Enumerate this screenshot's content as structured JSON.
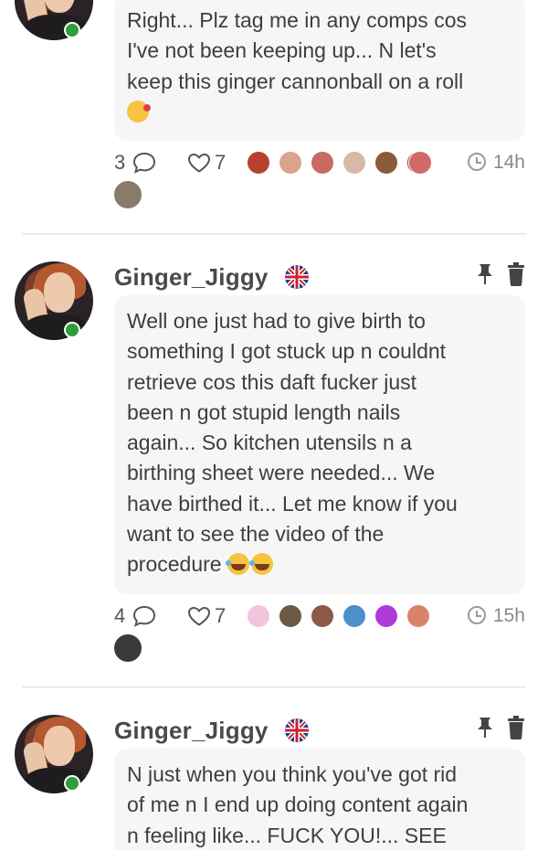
{
  "posts": [
    {
      "body_lines": [
        "Right... Plz tag me in any comps cos",
        "I've not been keeping up... N let's",
        "keep this ginger cannonball on a roll"
      ],
      "emoji": "kiss-emoji",
      "comments": "3",
      "likes": "7",
      "time": "14h",
      "liker_colors": [
        "#b8402f",
        "#d9a48a",
        "#c96a62",
        "#d8b9a6",
        "#8a5a3a",
        "#7a4c35",
        "#d06a6a"
      ],
      "extra_liker_color": "#8a7a6a"
    },
    {
      "username": "Ginger_Jiggy",
      "body_lines": [
        "Well one just had to give birth to",
        "something I got stuck up n couldnt",
        "retrieve cos this daft fucker just",
        "been n got stupid length nails",
        "again... So kitchen utensils n a",
        "birthing sheet were needed... We",
        "have birthed it... Let me know if you",
        "want to see the video of the",
        "procedure"
      ],
      "emoji": "laughing-tears-emoji",
      "comments": "4",
      "likes": "7",
      "time": "15h",
      "liker_colors": [
        "#f2c4de",
        "#6d5a44",
        "#8a5a46",
        "#4d8fc8",
        "#b03ad8",
        "#d9846a"
      ],
      "extra_liker_color": "#3a3a3a"
    },
    {
      "username": "Ginger_Jiggy",
      "body_lines": [
        "N just when you think you've got rid",
        "of me n I end up doing content again",
        "n feeling like... FUCK YOU!... SEE"
      ]
    }
  ],
  "colors": {
    "online": "#2e9e3a",
    "bubble": "#f6f6f6",
    "divider": "#ececec"
  }
}
